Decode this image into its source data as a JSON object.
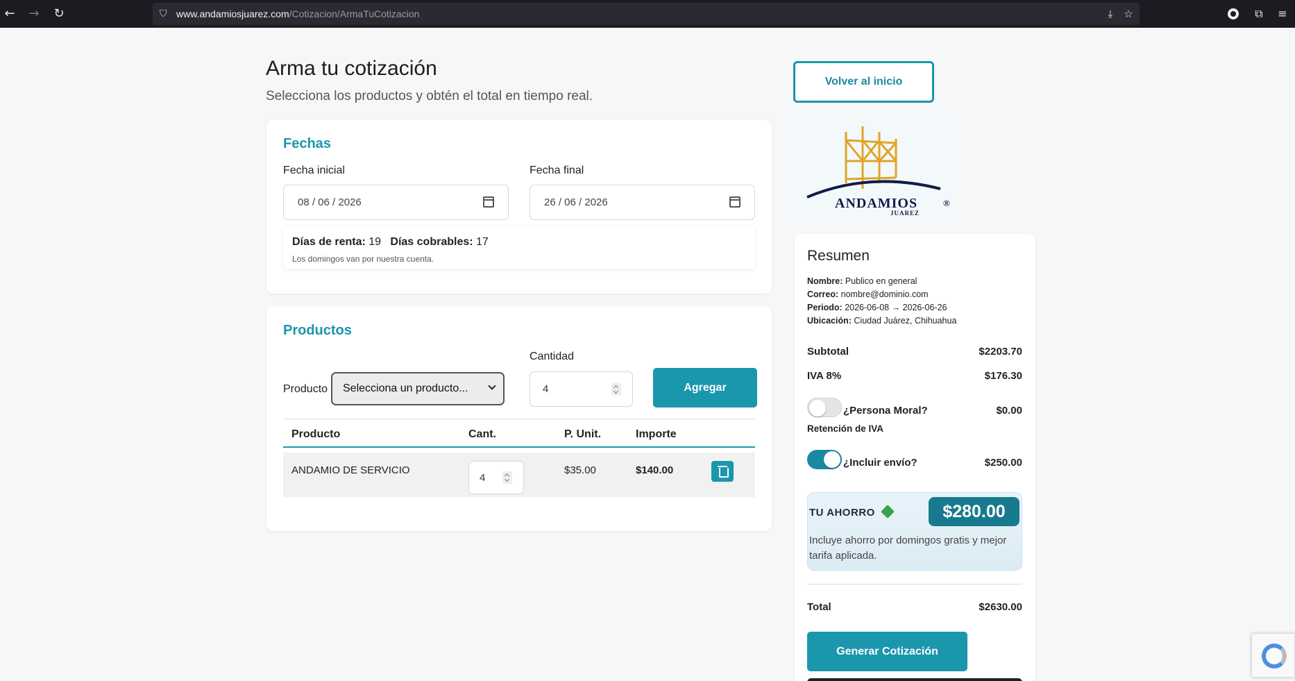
{
  "browser": {
    "url_host": "www.andamiosjuarez.com",
    "url_path": "/Cotizacion/ArmaTuCotizacion"
  },
  "page": {
    "title": "Arma tu cotización",
    "subtitle": "Selecciona los productos y obtén el total en tiempo real."
  },
  "fechas": {
    "section_title": "Fechas",
    "inicial_label": "Fecha inicial",
    "inicial_value": "08 / 06 / 2026",
    "final_label": "Fecha final",
    "final_value": "26 / 06 / 2026",
    "dias_renta_label": "Días de renta:",
    "dias_renta_value": "19",
    "dias_cobrables_label": "Días cobrables:",
    "dias_cobrables_value": "17",
    "note": "Los domingos van por nuestra cuenta."
  },
  "productos": {
    "section_title": "Productos",
    "producto_label": "Producto",
    "producto_select": "Selecciona un producto...",
    "cantidad_label": "Cantidad",
    "cantidad_value": "4",
    "agregar_label": "Agregar",
    "table": {
      "headers": [
        "Producto",
        "Cant.",
        "P. Unit.",
        "Importe"
      ],
      "rows": [
        {
          "producto": "ANDAMIO DE SERVICIO",
          "cant": "4",
          "p_unit": "$35.00",
          "importe": "$140.00"
        }
      ]
    }
  },
  "right": {
    "volver_label": "Volver al inicio",
    "logo_text": "ANDAMIOS",
    "logo_sub": "JUAREZ",
    "logo_reg": "®"
  },
  "resumen": {
    "title": "Resumen",
    "nombre_label": "Nombre:",
    "nombre_value": "Publico en general",
    "correo_label": "Correo:",
    "correo_value": "nombre@dominio.com",
    "periodo_label": "Periodo:",
    "periodo_value": "2026-06-08 → 2026-06-26",
    "ubicacion_label": "Ubicación:",
    "ubicacion_value": "Ciudad Juárez, Chihuahua",
    "subtotal_label": "Subtotal",
    "subtotal_value": "$2203.70",
    "iva_label": "IVA 8%",
    "iva_value": "$176.30",
    "persona_moral_label": "¿Persona Moral?",
    "persona_moral_value": "$0.00",
    "retencion_label": "Retención de IVA",
    "envio_label": "¿Incluir envío?",
    "envio_value": "$250.00",
    "ahorro_label": "TU AHORRO",
    "ahorro_value": "$280.00",
    "ahorro_note": "Incluye ahorro por domingos gratis y mejor tarifa aplicada.",
    "total_label": "Total",
    "total_value": "$2630.00",
    "generar_label": "Generar Cotización"
  },
  "colors": {
    "accent": "#1a96ad",
    "accent_dark": "#187a8e",
    "logo_navy": "#101c45",
    "logo_gold": "#e0a526"
  }
}
